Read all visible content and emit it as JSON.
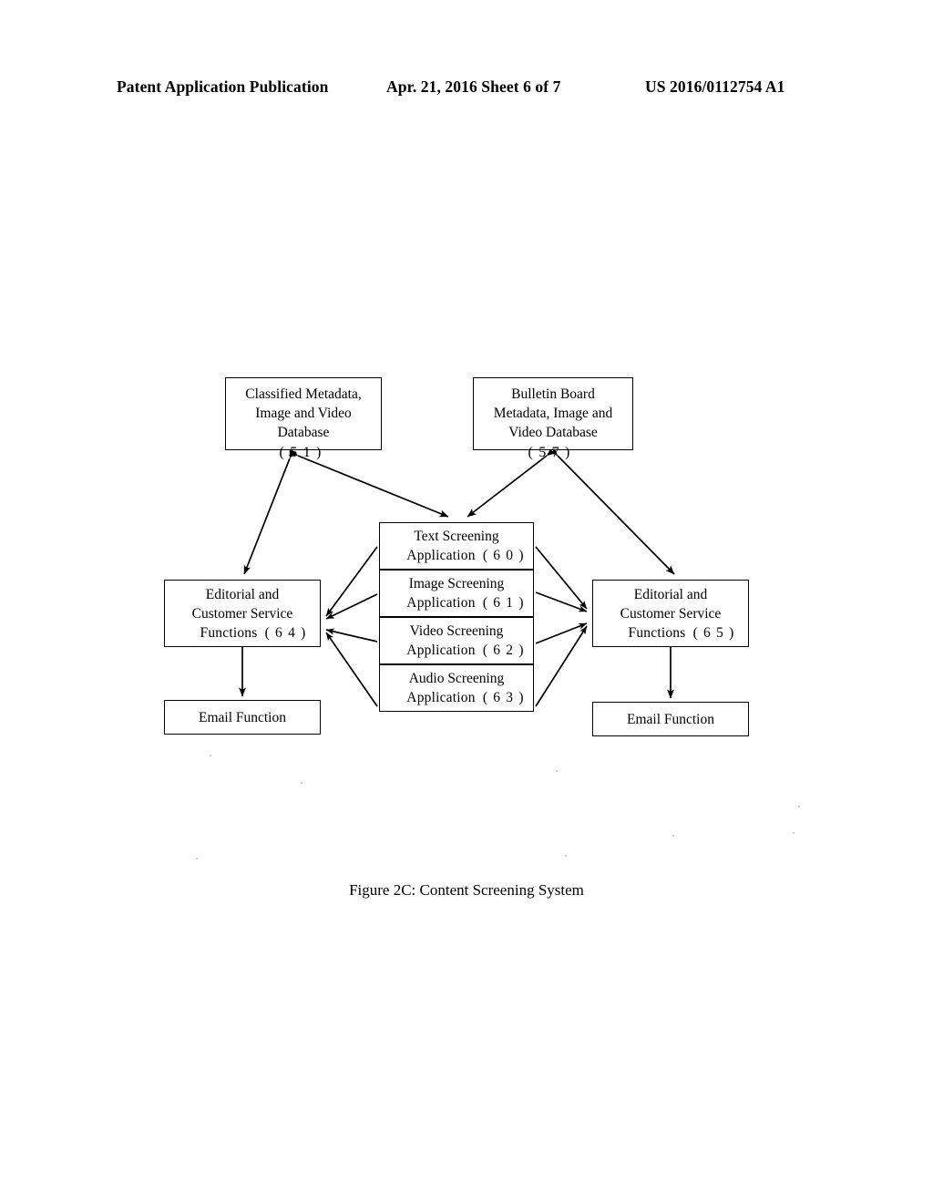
{
  "header": {
    "publication": "Patent Application Publication",
    "date_sheet": "Apr. 21, 2016  Sheet 6 of 7",
    "patent_number": "US 2016/0112754 A1"
  },
  "figure": {
    "caption": "Figure 2C:  Content Screening System"
  },
  "nodes": {
    "db_classified": {
      "line1": "Classified Metadata,",
      "line2": "Image and Video",
      "line3": "Database",
      "ref": "( 5 1 )"
    },
    "db_bulletin": {
      "line1": "Bulletin Board",
      "line2": "Metadata, Image and",
      "line3": "Video Database",
      "ref": "( 5 7 )"
    },
    "screening_text": {
      "line1": "Text Screening",
      "line2": "Application",
      "ref": "( 6 0 )"
    },
    "screening_image": {
      "line1": "Image Screening",
      "line2": "Application",
      "ref": "( 6 1 )"
    },
    "screening_video": {
      "line1": "Video Screening",
      "line2": "Application",
      "ref": "( 6 2 )"
    },
    "screening_audio": {
      "line1": "Audio Screening",
      "line2": "Application",
      "ref": "( 6 3 )"
    },
    "ecs_left": {
      "line1": "Editorial and",
      "line2": "Customer Service",
      "line3": "Functions",
      "ref": "( 6 4 )"
    },
    "ecs_right": {
      "line1": "Editorial and",
      "line2": "Customer Service",
      "line3": "Functions",
      "ref": "( 6 5 )"
    },
    "email_left": {
      "label": "Email Function"
    },
    "email_right": {
      "label": "Email Function"
    }
  },
  "connections": [
    {
      "name": "classified-db-to-ecs-left",
      "type": "double-arrow"
    },
    {
      "name": "classified-db-to-screening-stack",
      "type": "double-arrow"
    },
    {
      "name": "bulletin-db-to-screening-stack",
      "type": "double-arrow"
    },
    {
      "name": "bulletin-db-to-ecs-right",
      "type": "double-arrow"
    },
    {
      "name": "text-screening-to-ecs-left",
      "type": "single-arrow"
    },
    {
      "name": "image-screening-to-ecs-left",
      "type": "single-arrow"
    },
    {
      "name": "video-screening-to-ecs-left",
      "type": "single-arrow"
    },
    {
      "name": "audio-screening-to-ecs-left",
      "type": "single-arrow"
    },
    {
      "name": "text-screening-to-ecs-right",
      "type": "single-arrow"
    },
    {
      "name": "image-screening-to-ecs-right",
      "type": "single-arrow"
    },
    {
      "name": "video-screening-to-ecs-right",
      "type": "single-arrow"
    },
    {
      "name": "audio-screening-to-ecs-right",
      "type": "single-arrow"
    },
    {
      "name": "ecs-left-to-email-left",
      "type": "single-arrow"
    },
    {
      "name": "ecs-right-to-email-right",
      "type": "single-arrow"
    }
  ],
  "colors": {
    "ink": "#000000",
    "paper": "#ffffff"
  }
}
